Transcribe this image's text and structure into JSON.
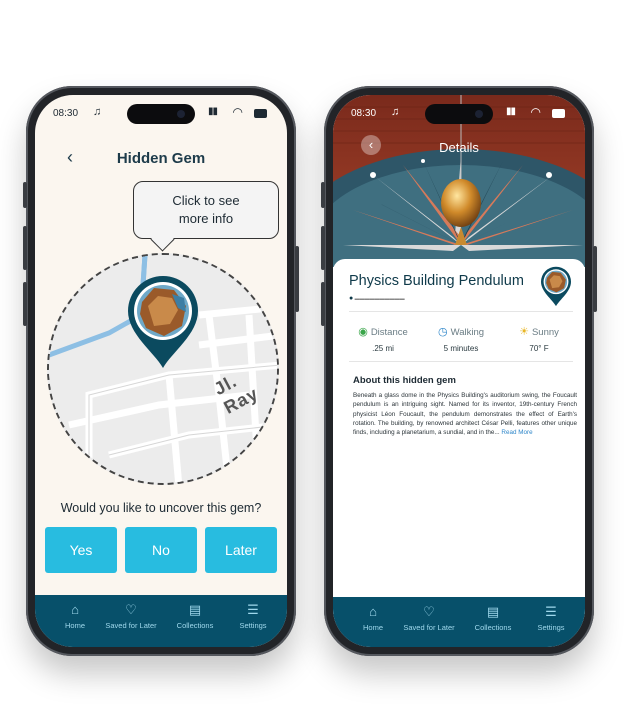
{
  "status_bar": {
    "time": "08:30",
    "music_icon": "music-note-icon"
  },
  "colors": {
    "primary_button": "#28bce0",
    "nav_bg": "#07506a",
    "nav_text": "#9fd8ec",
    "title": "#1d3b4a"
  },
  "hidden_gem_screen": {
    "title": "Hidden Gem",
    "tooltip": [
      "Click to see",
      "more info"
    ],
    "map_street": "Jl. Ray",
    "question": "Would you like to uncover this gem?",
    "buttons": {
      "yes": "Yes",
      "no": "No",
      "later": "Later"
    }
  },
  "details_screen": {
    "title": "Details",
    "place_name": "Physics Building Pendulum",
    "address": "",
    "stats": {
      "distance": {
        "label": "Distance",
        "value": ".25 mi",
        "icon": "map-pin-icon"
      },
      "walking": {
        "label": "Walking",
        "value": "5 minutes",
        "icon": "timer-icon"
      },
      "weather": {
        "label": "Sunny",
        "value": "70° F",
        "icon": "sun-icon"
      }
    },
    "about_title": "About this hidden gem",
    "about_text": "Beneath a glass dome in the Physics Building's auditorium swing, the Foucault pendulum is an intriguing sight. Named for its inventor, 19th-century French physicist Léon Foucault, the pendulum demonstrates the effect of Earth's rotation. The building, by renowned architect César Pelli, features other unique finds, including a planetarium, a sundial, and in the...",
    "read_more": "Read More"
  },
  "nav": {
    "home": "Home",
    "saved": "Saved for Later",
    "collections": "Collections",
    "settings": "Settings"
  }
}
